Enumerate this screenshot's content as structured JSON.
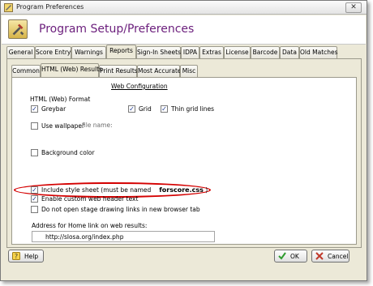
{
  "window": {
    "title": "Program Preferences"
  },
  "header": {
    "title": "Program Setup/Preferences"
  },
  "main_tabs": [
    "General",
    "Score Entry",
    "Warnings",
    "Reports",
    "Sign-In Sheets",
    "IDPA",
    "Extras",
    "License",
    "Barcode",
    "Data",
    "Old Matches"
  ],
  "sub_tabs": [
    "Common",
    "HTML (Web) Results",
    "Print Results",
    "Most Accurate",
    "Misc"
  ],
  "web_config": {
    "title": "Web Configuration",
    "format_label": "HTML (Web) Format",
    "greybar": "Greybar",
    "grid": "Grid",
    "thin_grid_lines": "Thin grid lines",
    "use_wallpaper": "Use wallpaper",
    "file_name_label": "file name:",
    "background_color": "Background color",
    "include_style_sheet": "Include style sheet (must be named",
    "style_sheet_name": "forscore.css",
    "style_sheet_close": ")",
    "enable_custom_header": "Enable custom web header text",
    "no_new_tab": "Do not open stage drawing links in new browser tab",
    "address_label": "Address for Home link on web results:",
    "address_value": "http://slosa.org/index.php"
  },
  "checks": {
    "greybar": true,
    "grid": true,
    "thin_grid_lines": true,
    "use_wallpaper": false,
    "background_color": false,
    "include_style_sheet": true,
    "enable_custom_header": true,
    "no_new_tab": false
  },
  "buttons": {
    "help": "Help",
    "ok": "OK",
    "cancel": "Cancel"
  },
  "colors": {
    "header_title": "#6b1e7c",
    "highlight": "#d40000",
    "ok_check": "#2e9b2e",
    "cancel_x": "#c0392b"
  }
}
